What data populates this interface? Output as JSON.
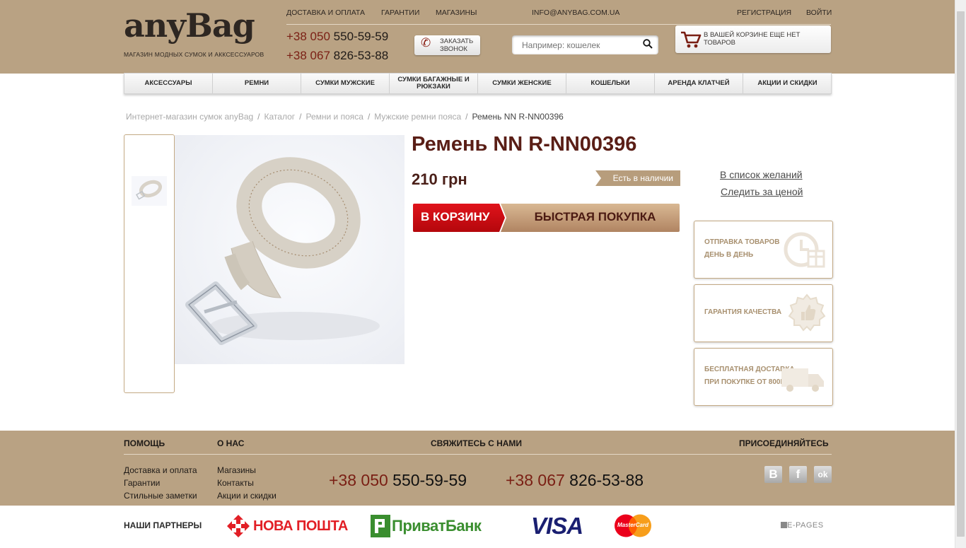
{
  "header": {
    "logo": "anyBag",
    "logo_sub": "МАГАЗИН МОДНЫХ СУМОК И АККСЕССУАРОВ",
    "nav": [
      "ДОСТАВКА И ОПЛАТА",
      "ГАРАНТИИ",
      "МАГАЗИНЫ"
    ],
    "email": "INFO@ANYBAG.COM.UA",
    "register": "РЕГИСТРАЦИЯ",
    "login": "ВОЙТИ",
    "phones": [
      {
        "code": "+38 050",
        "number": "550-59-59"
      },
      {
        "code": "+38 067",
        "number": "826-53-88"
      }
    ],
    "callback": "ЗАКАЗАТЬ ЗВОНОК",
    "search_placeholder": "Например: кошелек",
    "cart_text": "В ВАШЕЙ КОРЗИНЕ ЕЩЕ НЕТ ТОВАРОВ"
  },
  "categories": [
    "АКСЕССУАРЫ",
    "РЕМНИ",
    "СУМКИ МУЖСКИЕ",
    "СУМКИ БАГАЖНЫЕ И РЮКЗАКИ",
    "СУМКИ ЖЕНСКИЕ",
    "КОШЕЛЬКИ",
    "АРЕНДА КЛАТЧЕЙ",
    "АКЦИИ И СКИДКИ"
  ],
  "breadcrumb": [
    "Интернет-магазин сумок anyBag",
    "Каталог",
    "Ремни и пояса",
    "Мужские ремни пояса",
    "Ремень NN R-NN00396"
  ],
  "product": {
    "title": "Ремень NN R-NN00396",
    "price": "210 грн",
    "stock": "Есть в наличии",
    "add_to_cart": "В КОРЗИНУ",
    "quick_buy": "БЫСТРАЯ ПОКУПКА",
    "wishlist": "В список желаний",
    "track_price": "Следить за ценой"
  },
  "features": [
    {
      "line1": "ОТПРАВКА ТОВАРОВ",
      "line2": "ДЕНЬ В ДЕНЬ"
    },
    {
      "line1": "ГАРАНТИЯ КАЧЕСТВА",
      "line2": ""
    },
    {
      "line1": "БЕСПЛАТНАЯ ДОСТАВКА",
      "line2": "ПРИ ПОКУПКЕ ОТ 800ГРН"
    }
  ],
  "footer": {
    "help_title": "ПОМОЩЬ",
    "help_links": [
      "Доставка и оплата",
      "Гарантии",
      "Стильные заметки"
    ],
    "about_title": "О НАС",
    "about_links": [
      "Магазины",
      "Контакты",
      "Акции и скидки"
    ],
    "contact_title": "СВЯЖИТЕСЬ С НАМИ",
    "join_title": "ПРИСОЕДИНЯЙТЕСЬ",
    "phones": [
      {
        "code": "+38 050",
        "number": "550-59-59"
      },
      {
        "code": "+38 067",
        "number": "826-53-88"
      }
    ],
    "social": [
      "В",
      "f",
      "ok"
    ]
  },
  "partners": {
    "label": "НАШИ ПАРТНЕРЫ",
    "nova": "НОВА ПОШТА",
    "privat": "ПриватБанк",
    "visa": "VISA",
    "mastercard": "MasterCard",
    "epages": "E-PAGES"
  },
  "colors": {
    "header_bg": "#b9a283",
    "title": "#5a1e16",
    "cart_button": "#d10e16",
    "quick_button": "#c9a17a"
  }
}
